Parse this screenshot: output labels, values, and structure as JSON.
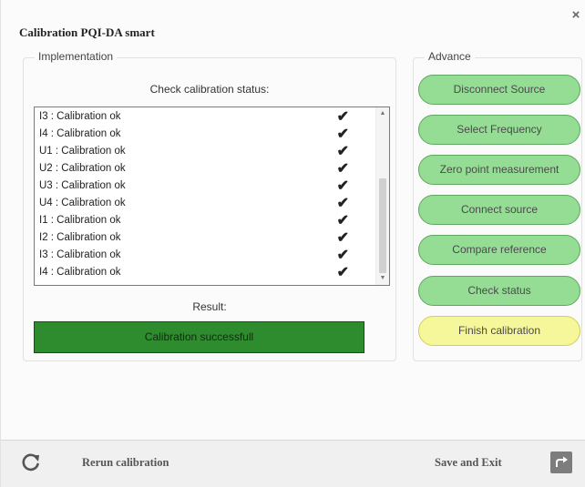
{
  "window": {
    "title": "Calibration PQI-DA smart",
    "close_glyph": "×"
  },
  "implementation": {
    "legend": "Implementation",
    "check_title": "Check calibration status:",
    "items": [
      "I3 : Calibration ok",
      "I4 : Calibration ok",
      "U1 : Calibration ok",
      "U2 : Calibration ok",
      "U3 : Calibration ok",
      "U4 : Calibration ok",
      "I1 : Calibration ok",
      "I2 : Calibration ok",
      "I3 : Calibration ok",
      "I4 : Calibration ok"
    ],
    "check_glyph": "✔",
    "result_label": "Result:",
    "result_text": "Calibration successfull"
  },
  "advance": {
    "legend": "Advance",
    "buttons": [
      "Disconnect Source",
      "Select Frequency",
      "Zero point measurement",
      "Connect source",
      "Compare reference",
      "Check status",
      "Finish calibration"
    ]
  },
  "footer": {
    "rerun_label": "Rerun calibration",
    "save_exit_label": "Save and Exit"
  },
  "colors": {
    "step_button": "#95dc95",
    "finish_button": "#f6f69a",
    "result_bar": "#2e8b2e"
  },
  "icons": {
    "close": "close-icon",
    "rerun": "refresh-icon",
    "exit": "exit-arrow-icon",
    "scroll_up": "scroll-up-arrow-icon",
    "scroll_down": "scroll-down-arrow-icon"
  }
}
